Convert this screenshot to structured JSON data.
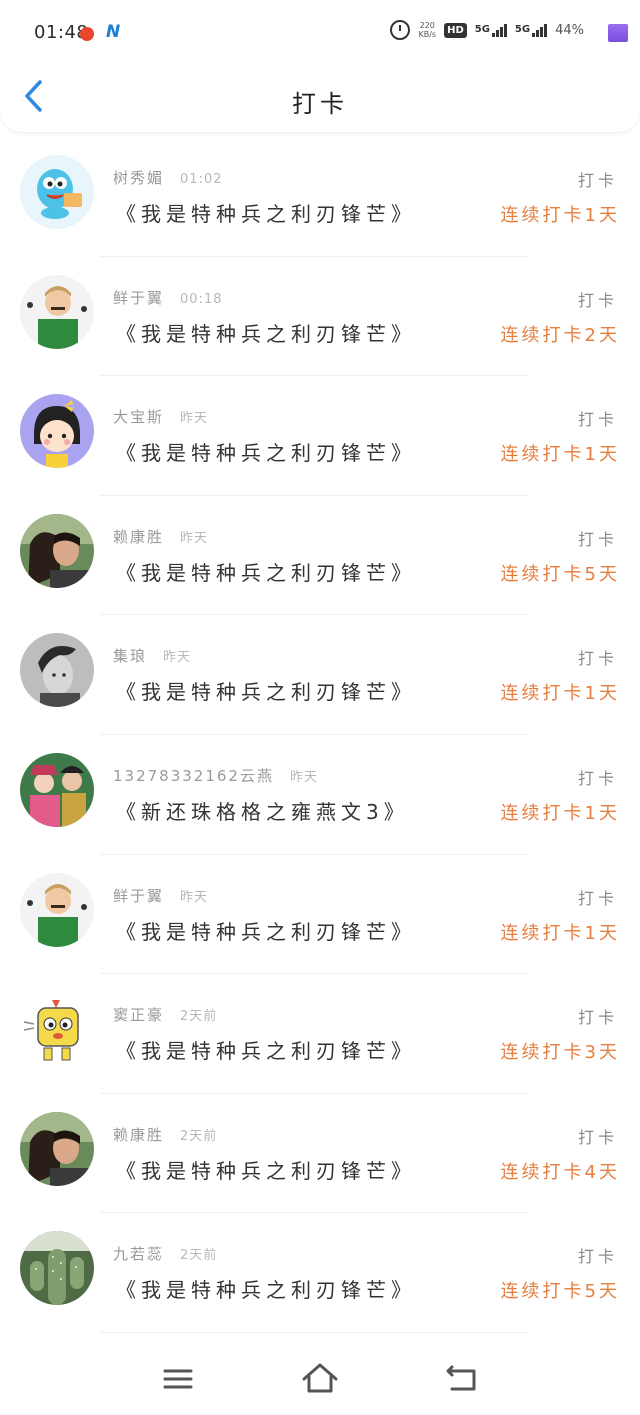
{
  "status_bar": {
    "time": "01:48",
    "net_speed_value": "220",
    "net_speed_unit": "KB/s",
    "hd_label": "HD",
    "sim1_label": "5G",
    "sim2_label": "5G",
    "battery": "44%"
  },
  "header": {
    "title": "打卡"
  },
  "list": [
    {
      "name": "树秀媚",
      "time": "01:02",
      "book": "《我是特种兵之利刃锋芒》",
      "action": "打卡",
      "streak": "连续打卡1天",
      "avatar": "cartoon-creature"
    },
    {
      "name": "鲜于翼",
      "time": "00:18",
      "book": "《我是特种兵之利刃锋芒》",
      "action": "打卡",
      "streak": "连续打卡2天",
      "avatar": "green-soldier"
    },
    {
      "name": "大宝斯",
      "time": "昨天",
      "book": "《我是特种兵之利刃锋芒》",
      "action": "打卡",
      "streak": "连续打卡1天",
      "avatar": "cartoon-girl"
    },
    {
      "name": "赖康胜",
      "time": "昨天",
      "book": "《我是特种兵之利刃锋芒》",
      "action": "打卡",
      "streak": "连续打卡5天",
      "avatar": "couple-photo"
    },
    {
      "name": "集琅",
      "time": "昨天",
      "book": "《我是特种兵之利刃锋芒》",
      "action": "打卡",
      "streak": "连续打卡1天",
      "avatar": "bw-portrait"
    },
    {
      "name": "13278332162云燕",
      "time": "昨天",
      "book": "《新还珠格格之雍燕文3》",
      "action": "打卡",
      "streak": "连续打卡1天",
      "avatar": "costume-photo"
    },
    {
      "name": "鲜于翼",
      "time": "昨天",
      "book": "《我是特种兵之利刃锋芒》",
      "action": "打卡",
      "streak": "连续打卡1天",
      "avatar": "green-soldier"
    },
    {
      "name": "窦正豪",
      "time": "2天前",
      "book": "《我是特种兵之利刃锋芒》",
      "action": "打卡",
      "streak": "连续打卡3天",
      "avatar": "yellow-cartoon"
    },
    {
      "name": "赖康胜",
      "time": "2天前",
      "book": "《我是特种兵之利刃锋芒》",
      "action": "打卡",
      "streak": "连续打卡4天",
      "avatar": "couple-photo"
    },
    {
      "name": "九若蕊",
      "time": "2天前",
      "book": "《我是特种兵之利刃锋芒》",
      "action": "打卡",
      "streak": "连续打卡5天",
      "avatar": "cactus-photo"
    }
  ],
  "colors": {
    "accent_blue": "#2f8be0",
    "streak_orange": "#e57e3f",
    "text_dark": "#333333",
    "text_gray": "#9a9a9a"
  },
  "icons": {
    "back": "chevron-left-icon",
    "nav_menu": "menu-icon",
    "nav_home": "home-icon",
    "nav_back": "return-icon",
    "alarm": "alarm-icon"
  }
}
